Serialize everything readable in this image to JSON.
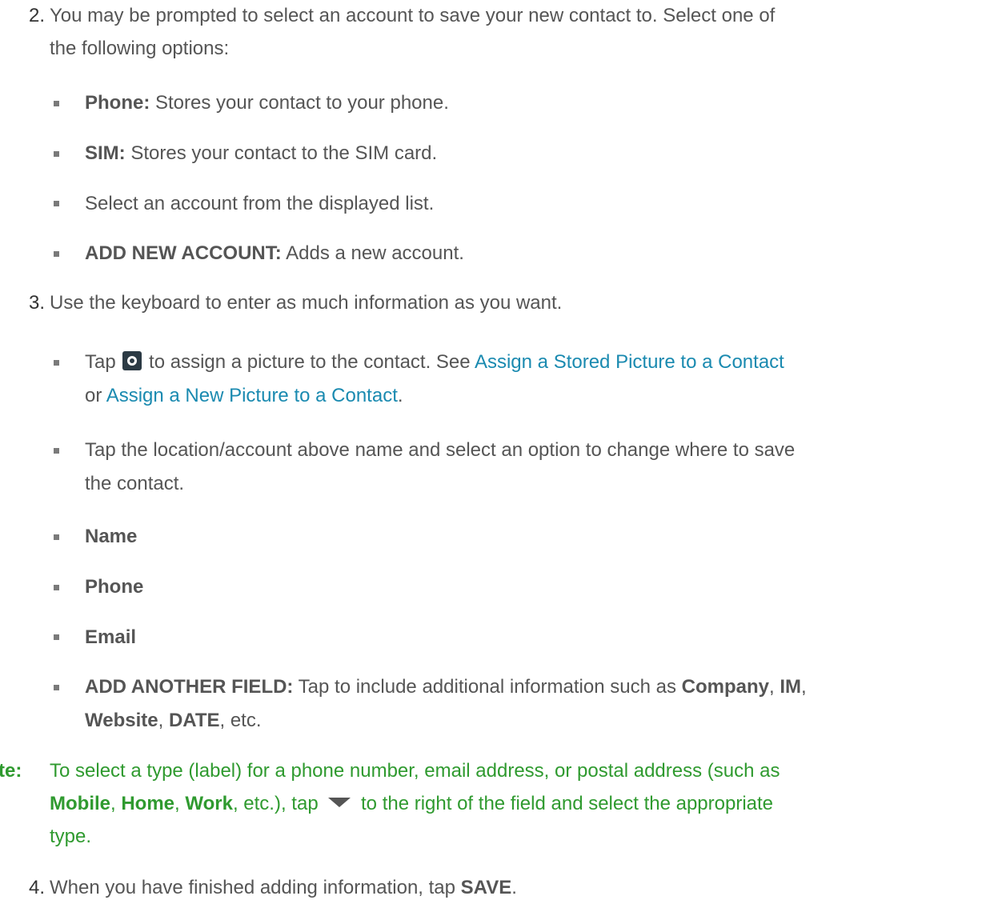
{
  "step2": {
    "number": "2.",
    "text_line1": "You may be prompted to select an account to save your new contact to. Select one of",
    "text_line2": "the following options:",
    "options": [
      {
        "bold": "Phone:",
        "text": " Stores your contact to your phone."
      },
      {
        "bold": "SIM:",
        "text": " Stores your contact to the SIM card."
      },
      {
        "bold": "",
        "text": "Select an account from the displayed list."
      },
      {
        "bold": "ADD NEW ACCOUNT:",
        "text": " Adds a new account."
      }
    ]
  },
  "step3": {
    "number": "3.",
    "text": "Use the keyboard to enter as much information as you want.",
    "picture": {
      "tap": "Tap",
      "icon": "camera-icon",
      "after_icon": "to assign a picture to the contact. See",
      "link1": "Assign a Stored Picture to a Contact",
      "or": "or",
      "link2": "Assign a New Picture to a Contact",
      "period": "."
    },
    "location": {
      "line1": "Tap the location/account above name and select an option to change where to save",
      "line2": "the contact."
    },
    "fields": [
      "Name",
      "Phone",
      "Email"
    ],
    "another": {
      "bold": "ADD ANOTHER FIELD:",
      "text": " Tap to include additional information such as ",
      "company": "Company",
      "comma1": ", ",
      "im": "IM",
      "comma2": ",",
      "website": "Website",
      "comma3": ", ",
      "date": "DATE",
      "etc": ", etc."
    }
  },
  "note": {
    "label": "te:",
    "line1": "To select a type (label) for a phone number, email address, or postal address (such as",
    "mobile": "Mobile",
    "c1": ", ",
    "home": "Home",
    "c2": ", ",
    "work": "Work",
    "etc_tap": ", etc.), tap",
    "icon": "dropdown-triangle-icon",
    "after_icon": "to the right of the field and select the appropriate",
    "line3": "type.",
    "color": "#2f9a2f"
  },
  "step4": {
    "number": "4.",
    "text": "When you have finished adding information, tap ",
    "save": "SAVE",
    "period": "."
  }
}
